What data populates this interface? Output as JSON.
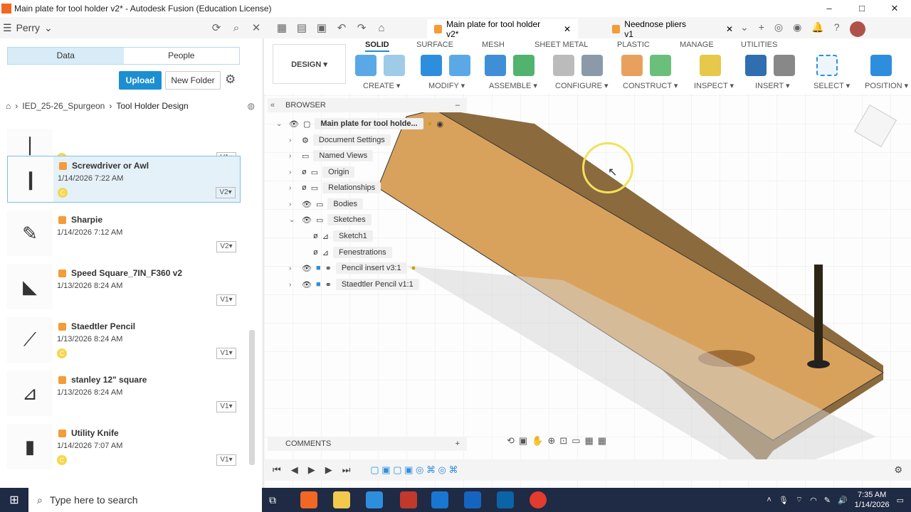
{
  "window": {
    "title": "Main plate for tool holder v2* - Autodesk Fusion (Education License)",
    "controls": [
      "–",
      "□",
      "✕"
    ]
  },
  "appbar": {
    "user": "Perry"
  },
  "tabs": [
    {
      "label": "Main plate for tool holder v2*",
      "close": "✕"
    },
    {
      "label": "Neednose pliers v1",
      "close": "✕"
    }
  ],
  "data_panel": {
    "segments": [
      "Data",
      "People"
    ],
    "upload": "Upload",
    "new_folder": "New Folder",
    "breadcrumb": [
      "IED_25-26_Spurgeon",
      "Tool Holder Design"
    ],
    "items": [
      {
        "name": "",
        "date": "",
        "badge": "C",
        "version": "V1▾"
      },
      {
        "name": "Screwdriver or Awl",
        "date": "1/14/2026 7:22 AM",
        "badge": "C",
        "version": "V2▾"
      },
      {
        "name": "Sharpie",
        "date": "1/14/2026 7:12 AM",
        "badge": "",
        "version": "V2▾"
      },
      {
        "name": "Speed Square_7IN_F360 v2",
        "date": "1/13/2026 8:24 AM",
        "badge": "",
        "version": "V1▾"
      },
      {
        "name": "Staedtler Pencil",
        "date": "1/13/2026 8:24 AM",
        "badge": "C",
        "version": "V1▾"
      },
      {
        "name": "stanley 12\" square",
        "date": "1/13/2026 8:24 AM",
        "badge": "",
        "version": "V1▾"
      },
      {
        "name": "Utility Knife",
        "date": "1/14/2026 7:07 AM",
        "badge": "C",
        "version": "V1▾"
      }
    ]
  },
  "toolbar": {
    "design": "DESIGN",
    "tabs": [
      "SOLID",
      "SURFACE",
      "MESH",
      "SHEET METAL",
      "PLASTIC",
      "MANAGE",
      "UTILITIES"
    ],
    "groups": [
      "CREATE ▾",
      "MODIFY ▾",
      "ASSEMBLE ▾",
      "CONFIGURE ▾",
      "CONSTRUCT ▾",
      "INSPECT ▾",
      "INSERT ▾",
      "SELECT ▾",
      "POSITION ▾"
    ]
  },
  "browser": {
    "title": "BROWSER",
    "root": "Main plate for tool holde...",
    "nodes": [
      "Document Settings",
      "Named Views",
      "Origin",
      "Relationships",
      "Bodies",
      "Sketches",
      "Sketch1",
      "Fenestrations",
      "Pencil insert v3:1",
      "Staedtler Pencil v1:1"
    ]
  },
  "comments": "COMMENTS",
  "taskbar": {
    "search_placeholder": "Type here to search",
    "time": "7:35 AM",
    "date": "1/14/2026"
  },
  "colors": {
    "accent": "#1b8fd1",
    "wood": "#d9a25c",
    "taskbar": "#1f2a44"
  }
}
